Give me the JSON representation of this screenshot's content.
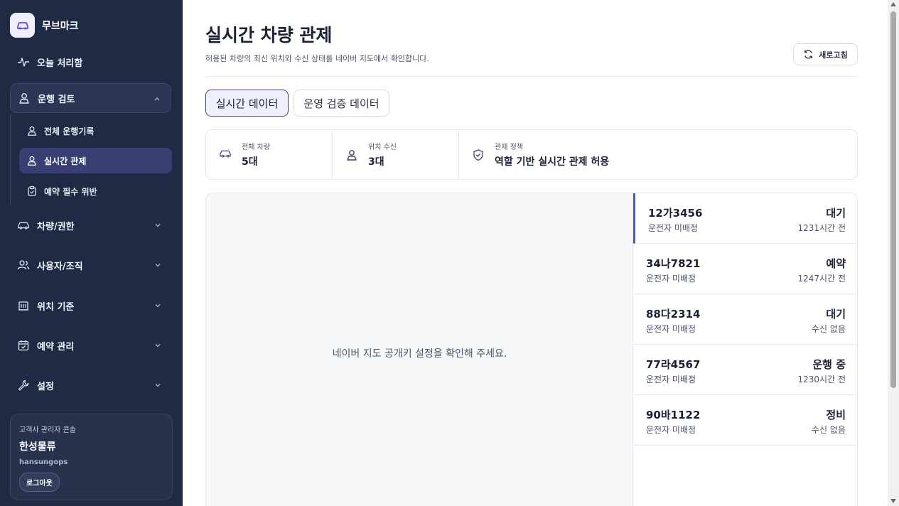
{
  "brand": {
    "name": "무브마크"
  },
  "sidebar": {
    "today": {
      "label": "오늘 처리함"
    },
    "operation_review": {
      "label": "운행 검토"
    },
    "sub_items": [
      {
        "label": "전체 운행기록"
      },
      {
        "label": "실시간 관제"
      },
      {
        "label": "예약 필수 위반"
      }
    ],
    "groups": [
      {
        "label": "차량/권한"
      },
      {
        "label": "사용자/조직"
      },
      {
        "label": "위치 기준"
      },
      {
        "label": "예약 관리"
      },
      {
        "label": "설정"
      }
    ],
    "account": {
      "role": "고객사 관리자 콘솔",
      "company": "한성물류",
      "username": "hansungops",
      "logout_label": "로그아웃"
    }
  },
  "header": {
    "title": "실시간 차량 관제",
    "subtitle": "허용된 차량의 최신 위치와 수신 상태를 네이버 지도에서 확인합니다.",
    "refresh_label": "새로고침"
  },
  "tabs": [
    {
      "label": "실시간 데이터"
    },
    {
      "label": "운영 검증 데이터"
    }
  ],
  "stats": [
    {
      "label": "전체 차량",
      "value": "5대"
    },
    {
      "label": "위치 수신",
      "value": "3대"
    },
    {
      "label": "관제 정책",
      "value": "역할 기반 실시간 관제 허용"
    }
  ],
  "map": {
    "message": "네이버 지도 공개키 설정을 확인해 주세요."
  },
  "vehicles": [
    {
      "plate": "12가3456",
      "driver": "운전자 미배정",
      "status": "대기",
      "time": "1231시간 전"
    },
    {
      "plate": "34나7821",
      "driver": "운전자 미배정",
      "status": "예약",
      "time": "1247시간 전"
    },
    {
      "plate": "88다2314",
      "driver": "운전자 미배정",
      "status": "대기",
      "time": "수신 없음"
    },
    {
      "plate": "77라4567",
      "driver": "운전자 미배정",
      "status": "운행 중",
      "time": "1230시간 전"
    },
    {
      "plate": "90바1122",
      "driver": "운전자 미배정",
      "status": "정비",
      "time": "수신 없음"
    }
  ],
  "colors": {
    "sidebar_bg": "#1f2a44",
    "accent": "#4a5bc4",
    "active_sub": "#3a3f73"
  }
}
